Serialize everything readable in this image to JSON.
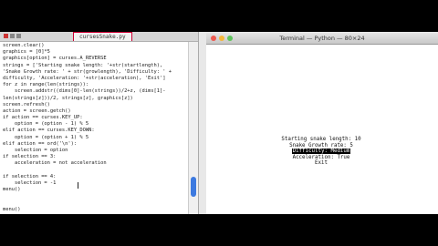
{
  "editor": {
    "tab_label": "cursesSnake.py",
    "code_lines": [
      "screen.clear()",
      "graphics = [0]*5",
      "graphics[option] = curses.A_REVERSE",
      "strings = ['Starting snake length: '+str(startlength),",
      "'Snake Growth rate: ' + str(growlength), 'Difficulty: ' +",
      "difficulty, 'Acceleration: '+str(acceleration), 'Exit']",
      "for z in range(len(strings)):",
      "    screen.addstr((dims[0]-len(strings))/2+z, (dims[1]-",
      "len(strings[z]))/2, strings[z], graphics[z])",
      "screen.refresh()",
      "action = screen.getch()",
      "if action == curses.KEY_UP:",
      "    option = (option - 1) % 5",
      "elif action == curses.KEY_DOWN:",
      "    option = (option + 1) % 5",
      "elif action == ord('\\n'):",
      "    selection = option",
      "if selection == 3:",
      "    acceleration = not acceleration",
      "",
      "if selection == 4:",
      "    selection = -1",
      "menu()",
      "",
      "",
      "menu()"
    ]
  },
  "terminal": {
    "title": "Terminal — Python — 80×24",
    "menu_items": [
      "Starting snake length: 10",
      "Snake Growth rate: 5",
      "Difficulty: Medium",
      "Acceleration: True",
      "Exit"
    ],
    "selected_index": 2
  },
  "colors": {
    "selection_bg": "#000000",
    "scroll_thumb": "#3d7ae0",
    "close_btn": "#ee5a50",
    "min_btn": "#f5b73a",
    "max_btn": "#5cc45a"
  }
}
